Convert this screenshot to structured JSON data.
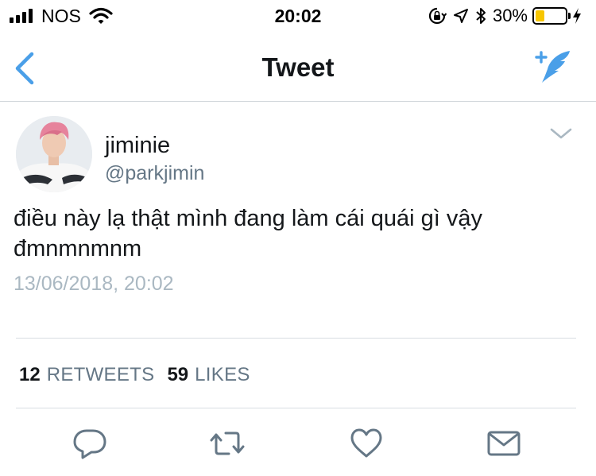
{
  "status_bar": {
    "carrier": "NOS",
    "time": "20:02",
    "battery_percent": "30%",
    "battery_level": 0.3,
    "battery_color": "#f7c600"
  },
  "nav": {
    "title": "Tweet",
    "back_icon": "chevron-left-icon",
    "compose_icon": "compose-tweet-icon",
    "accent_color": "#4a9fe8"
  },
  "tweet": {
    "user_name": "jiminie",
    "handle": "@parkjimin",
    "text": "điều này lạ thật mình đang làm cái quái gì vậy đmnmnmnm",
    "timestamp": "13/06/2018, 20:02",
    "retweets_count": "12",
    "retweets_label": "RETWEETS",
    "likes_count": "59",
    "likes_label": "LIKES"
  },
  "actions": [
    {
      "name": "reply",
      "icon": "reply-icon"
    },
    {
      "name": "retweet",
      "icon": "retweet-icon"
    },
    {
      "name": "like",
      "icon": "heart-icon"
    },
    {
      "name": "direct-message",
      "icon": "envelope-icon"
    }
  ]
}
